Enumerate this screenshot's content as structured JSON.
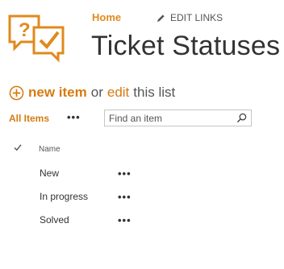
{
  "header": {
    "site_logo_icon": "question-check-speech-bubbles-icon",
    "nav_home": "Home",
    "edit_links": "EDIT LINKS",
    "page_title": "Ticket Statuses",
    "accent_color": "#e08a1c"
  },
  "actions": {
    "new_item": "new item",
    "or": "or",
    "edit": "edit",
    "this_list": "this list"
  },
  "view": {
    "all_items": "All Items",
    "more": "•••",
    "search_placeholder": "Find an item"
  },
  "list": {
    "column_name": "Name",
    "rows": [
      {
        "name": "New",
        "menu": "•••"
      },
      {
        "name": "In progress",
        "menu": "•••"
      },
      {
        "name": "Solved",
        "menu": "•••"
      }
    ]
  }
}
